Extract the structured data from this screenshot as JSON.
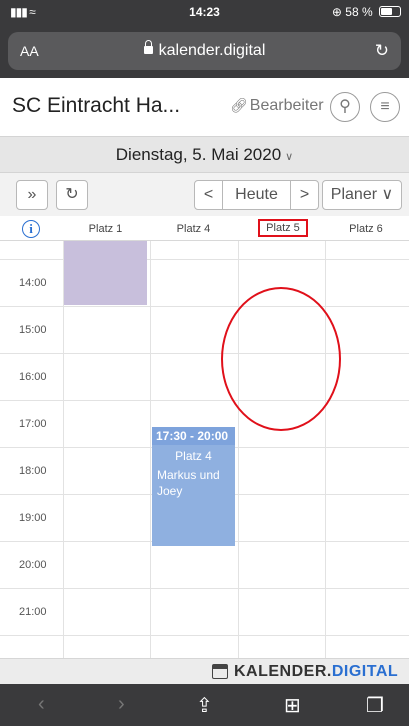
{
  "status_bar": {
    "time": "14:23",
    "signal": "▮▮▮ ≈",
    "battery_text": "⊕ 58 %"
  },
  "browser": {
    "text_size_label": "AA",
    "url": "kalender.digital"
  },
  "header": {
    "title": "SC Eintracht Ha...",
    "editor_label": "Bearbeiter"
  },
  "date_bar": {
    "date": "Dienstag, 5. Mai 2020"
  },
  "toolbar": {
    "expand_label": "»",
    "refresh_label": "↻",
    "prev_label": "<",
    "today_label": "Heute",
    "next_label": ">",
    "view_label": "Planer ∨"
  },
  "columns": {
    "info_label": "i",
    "headers": [
      "Platz 1",
      "Platz 4",
      "Platz 5",
      "Platz 6"
    ],
    "highlighted_index": 2
  },
  "schedule": {
    "hours": [
      "14:00",
      "15:00",
      "16:00",
      "17:00",
      "18:00",
      "19:00",
      "20:00",
      "21:00"
    ],
    "bookings": [
      {
        "column": "Platz 1",
        "color": "#c8bfdc",
        "time": "",
        "title": "",
        "text": ""
      },
      {
        "column": "Platz 4",
        "color": "#8fb0e0",
        "time": "17:30 - 20:00",
        "title": "Platz 4",
        "text": "Markus und Joey"
      }
    ]
  },
  "brand": {
    "part1": "KALENDER.",
    "part2": "DIGITAL",
    "accent_color": "#2a6fd1"
  },
  "annotation_color": "#e0101a"
}
